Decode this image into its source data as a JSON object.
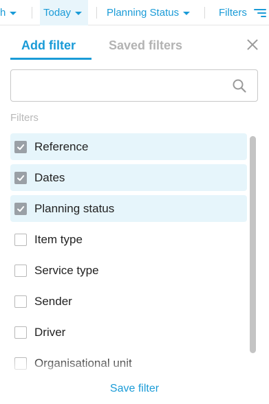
{
  "toolbar": {
    "partial_label": "h",
    "today_label": "Today",
    "planning_status_label": "Planning Status",
    "filters_label": "Filters"
  },
  "panel": {
    "tabs": [
      {
        "label": "Add filter",
        "active": true
      },
      {
        "label": "Saved filters",
        "active": false
      }
    ],
    "search": {
      "value": "",
      "placeholder": ""
    },
    "section_label": "Filters",
    "items": [
      {
        "label": "Reference",
        "checked": true
      },
      {
        "label": "Dates",
        "checked": true
      },
      {
        "label": "Planning status",
        "checked": true
      },
      {
        "label": "Item type",
        "checked": false
      },
      {
        "label": "Service type",
        "checked": false
      },
      {
        "label": "Sender",
        "checked": false
      },
      {
        "label": "Driver",
        "checked": false
      },
      {
        "label": "Organisational unit",
        "checked": false
      }
    ],
    "save_label": "Save filter"
  },
  "colors": {
    "accent": "#1a9bd7",
    "checked_row_bg": "#e6f5fb",
    "checked_box": "#9aa0a6"
  },
  "icons": [
    "caret-down-icon",
    "filters-icon",
    "close-icon",
    "search-icon",
    "checkmark-icon"
  ]
}
